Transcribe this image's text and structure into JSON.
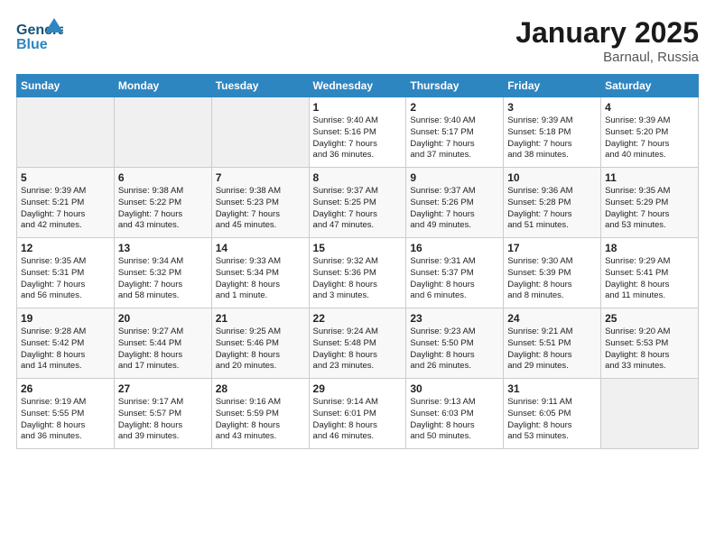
{
  "header": {
    "logo_general": "General",
    "logo_blue": "Blue",
    "month_year": "January 2025",
    "location": "Barnaul, Russia"
  },
  "days_of_week": [
    "Sunday",
    "Monday",
    "Tuesday",
    "Wednesday",
    "Thursday",
    "Friday",
    "Saturday"
  ],
  "weeks": [
    [
      {
        "day": "",
        "content": ""
      },
      {
        "day": "",
        "content": ""
      },
      {
        "day": "",
        "content": ""
      },
      {
        "day": "1",
        "content": "Sunrise: 9:40 AM\nSunset: 5:16 PM\nDaylight: 7 hours\nand 36 minutes."
      },
      {
        "day": "2",
        "content": "Sunrise: 9:40 AM\nSunset: 5:17 PM\nDaylight: 7 hours\nand 37 minutes."
      },
      {
        "day": "3",
        "content": "Sunrise: 9:39 AM\nSunset: 5:18 PM\nDaylight: 7 hours\nand 38 minutes."
      },
      {
        "day": "4",
        "content": "Sunrise: 9:39 AM\nSunset: 5:20 PM\nDaylight: 7 hours\nand 40 minutes."
      }
    ],
    [
      {
        "day": "5",
        "content": "Sunrise: 9:39 AM\nSunset: 5:21 PM\nDaylight: 7 hours\nand 42 minutes."
      },
      {
        "day": "6",
        "content": "Sunrise: 9:38 AM\nSunset: 5:22 PM\nDaylight: 7 hours\nand 43 minutes."
      },
      {
        "day": "7",
        "content": "Sunrise: 9:38 AM\nSunset: 5:23 PM\nDaylight: 7 hours\nand 45 minutes."
      },
      {
        "day": "8",
        "content": "Sunrise: 9:37 AM\nSunset: 5:25 PM\nDaylight: 7 hours\nand 47 minutes."
      },
      {
        "day": "9",
        "content": "Sunrise: 9:37 AM\nSunset: 5:26 PM\nDaylight: 7 hours\nand 49 minutes."
      },
      {
        "day": "10",
        "content": "Sunrise: 9:36 AM\nSunset: 5:28 PM\nDaylight: 7 hours\nand 51 minutes."
      },
      {
        "day": "11",
        "content": "Sunrise: 9:35 AM\nSunset: 5:29 PM\nDaylight: 7 hours\nand 53 minutes."
      }
    ],
    [
      {
        "day": "12",
        "content": "Sunrise: 9:35 AM\nSunset: 5:31 PM\nDaylight: 7 hours\nand 56 minutes."
      },
      {
        "day": "13",
        "content": "Sunrise: 9:34 AM\nSunset: 5:32 PM\nDaylight: 7 hours\nand 58 minutes."
      },
      {
        "day": "14",
        "content": "Sunrise: 9:33 AM\nSunset: 5:34 PM\nDaylight: 8 hours\nand 1 minute."
      },
      {
        "day": "15",
        "content": "Sunrise: 9:32 AM\nSunset: 5:36 PM\nDaylight: 8 hours\nand 3 minutes."
      },
      {
        "day": "16",
        "content": "Sunrise: 9:31 AM\nSunset: 5:37 PM\nDaylight: 8 hours\nand 6 minutes."
      },
      {
        "day": "17",
        "content": "Sunrise: 9:30 AM\nSunset: 5:39 PM\nDaylight: 8 hours\nand 8 minutes."
      },
      {
        "day": "18",
        "content": "Sunrise: 9:29 AM\nSunset: 5:41 PM\nDaylight: 8 hours\nand 11 minutes."
      }
    ],
    [
      {
        "day": "19",
        "content": "Sunrise: 9:28 AM\nSunset: 5:42 PM\nDaylight: 8 hours\nand 14 minutes."
      },
      {
        "day": "20",
        "content": "Sunrise: 9:27 AM\nSunset: 5:44 PM\nDaylight: 8 hours\nand 17 minutes."
      },
      {
        "day": "21",
        "content": "Sunrise: 9:25 AM\nSunset: 5:46 PM\nDaylight: 8 hours\nand 20 minutes."
      },
      {
        "day": "22",
        "content": "Sunrise: 9:24 AM\nSunset: 5:48 PM\nDaylight: 8 hours\nand 23 minutes."
      },
      {
        "day": "23",
        "content": "Sunrise: 9:23 AM\nSunset: 5:50 PM\nDaylight: 8 hours\nand 26 minutes."
      },
      {
        "day": "24",
        "content": "Sunrise: 9:21 AM\nSunset: 5:51 PM\nDaylight: 8 hours\nand 29 minutes."
      },
      {
        "day": "25",
        "content": "Sunrise: 9:20 AM\nSunset: 5:53 PM\nDaylight: 8 hours\nand 33 minutes."
      }
    ],
    [
      {
        "day": "26",
        "content": "Sunrise: 9:19 AM\nSunset: 5:55 PM\nDaylight: 8 hours\nand 36 minutes."
      },
      {
        "day": "27",
        "content": "Sunrise: 9:17 AM\nSunset: 5:57 PM\nDaylight: 8 hours\nand 39 minutes."
      },
      {
        "day": "28",
        "content": "Sunrise: 9:16 AM\nSunset: 5:59 PM\nDaylight: 8 hours\nand 43 minutes."
      },
      {
        "day": "29",
        "content": "Sunrise: 9:14 AM\nSunset: 6:01 PM\nDaylight: 8 hours\nand 46 minutes."
      },
      {
        "day": "30",
        "content": "Sunrise: 9:13 AM\nSunset: 6:03 PM\nDaylight: 8 hours\nand 50 minutes."
      },
      {
        "day": "31",
        "content": "Sunrise: 9:11 AM\nSunset: 6:05 PM\nDaylight: 8 hours\nand 53 minutes."
      },
      {
        "day": "",
        "content": ""
      }
    ]
  ]
}
